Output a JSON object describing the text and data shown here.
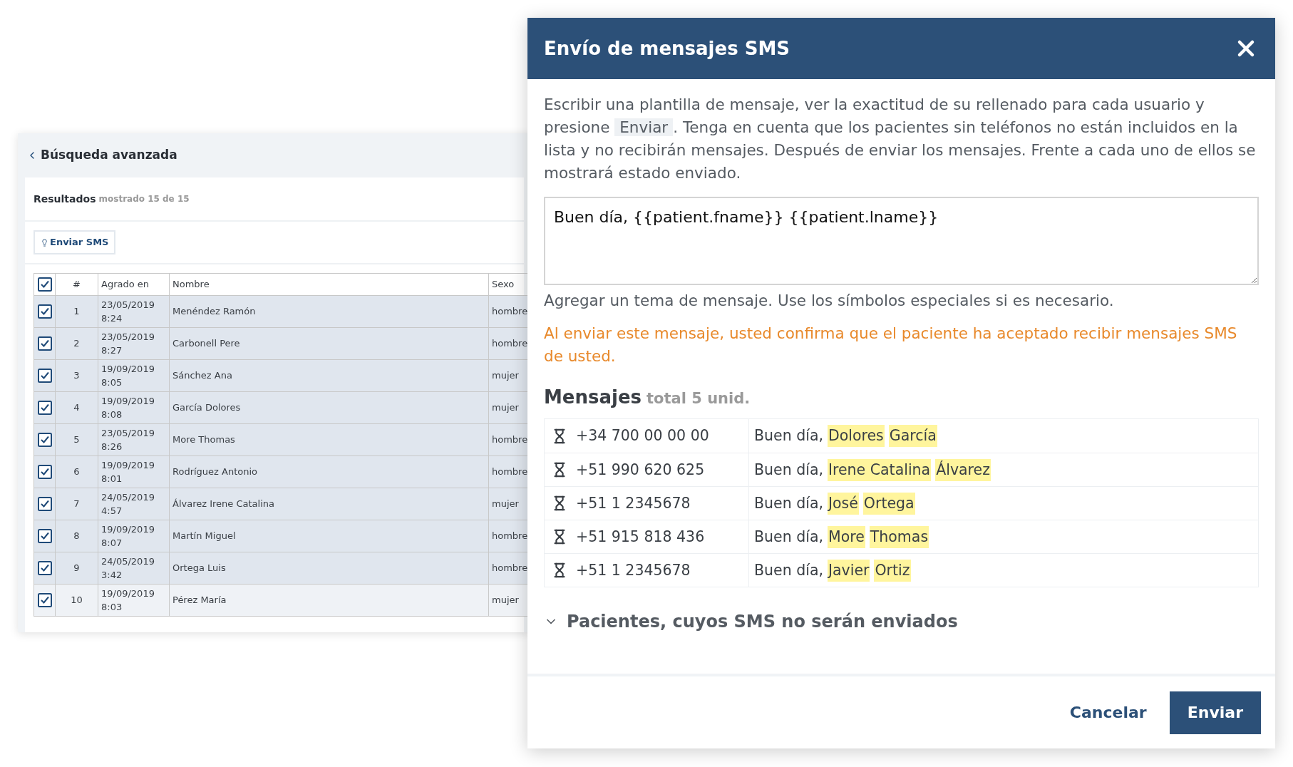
{
  "search_panel": {
    "back_title": "Búsqueda avanzada",
    "results_label": "Resultados",
    "results_count": "mostrado 15 de 15",
    "send_button": "Enviar SMS",
    "table": {
      "header_checked": true,
      "columns": [
        "#",
        "Agrado en",
        "Nombre",
        "Sexo"
      ],
      "rows": [
        {
          "checked": true,
          "highlighted": true,
          "num": "1",
          "date": "23/05/2019",
          "time": "8:24",
          "name": "Menéndez Ramón",
          "sex": "hombre"
        },
        {
          "checked": true,
          "highlighted": true,
          "num": "2",
          "date": "23/05/2019",
          "time": "8:27",
          "name": "Carbonell Pere",
          "sex": "hombre"
        },
        {
          "checked": true,
          "highlighted": true,
          "num": "3",
          "date": "19/09/2019",
          "time": "8:05",
          "name": "Sánchez Ana",
          "sex": "mujer"
        },
        {
          "checked": true,
          "highlighted": true,
          "num": "4",
          "date": "19/09/2019",
          "time": "8:08",
          "name": "García Dolores",
          "sex": "mujer"
        },
        {
          "checked": true,
          "highlighted": true,
          "num": "5",
          "date": "23/05/2019",
          "time": "8:26",
          "name": "More Thomas",
          "sex": "hombre"
        },
        {
          "checked": true,
          "highlighted": true,
          "num": "6",
          "date": "19/09/2019",
          "time": "8:01",
          "name": "Rodríguez Antonio",
          "sex": "hombre"
        },
        {
          "checked": true,
          "highlighted": true,
          "num": "7",
          "date": "24/05/2019",
          "time": "4:57",
          "name": "Álvarez Irene Catalina",
          "sex": "mujer"
        },
        {
          "checked": true,
          "highlighted": true,
          "num": "8",
          "date": "19/09/2019",
          "time": "8:07",
          "name": "Martín Miguel",
          "sex": "hombre"
        },
        {
          "checked": true,
          "highlighted": true,
          "num": "9",
          "date": "24/05/2019",
          "time": "3:42",
          "name": "Ortega Luis",
          "sex": "hombre"
        },
        {
          "checked": true,
          "highlighted": false,
          "num": "10",
          "date": "19/09/2019",
          "time": "8:03",
          "name": "Pérez María",
          "sex": "mujer"
        }
      ]
    }
  },
  "dialog": {
    "title": "Envío de mensajes SMS",
    "description_before": "Escribir una plantilla de mensaje, ver la exactitud de su rellenado para cada usuario y presione",
    "description_button": "Enviar",
    "description_after": ". Tenga en cuenta que los pacientes sin teléfonos no están incluidos en la lista y no recibirán mensajes. Después de enviar los mensajes. Frente a cada uno de ellos se mostrará estado enviado.",
    "template_value": "Buen día, {{patient.fname}} {{patient.lname}}",
    "hint": "Agregar un tema de mensaje. Use los símbolos especiales si es necesario.",
    "warning": "Al enviar este mensaje, usted confirma que el paciente ha aceptado recibir mensajes SMS de usted.",
    "messages_title": "Mensajes",
    "messages_total": "total 5 unid.",
    "messages": [
      {
        "phone": "+34 700 00 00 00",
        "greeting": "Buen día,",
        "names": [
          "Dolores",
          "García"
        ]
      },
      {
        "phone": "+51 990 620 625",
        "greeting": "Buen día,",
        "names": [
          "Irene Catalina",
          "Álvarez"
        ]
      },
      {
        "phone": "+51 1 2345678",
        "greeting": "Buen día,",
        "names": [
          "José",
          "Ortega"
        ]
      },
      {
        "phone": "+51 915 818 436",
        "greeting": "Buen día,",
        "names": [
          "More",
          "Thomas"
        ]
      },
      {
        "phone": "+51 1 2345678",
        "greeting": "Buen día,",
        "names": [
          "Javier",
          "Ortiz"
        ]
      }
    ],
    "excluded_section": {
      "label": "Pacientes, cuyos SMS no serán enviados",
      "expanded": false
    },
    "buttons": {
      "cancel": "Cancelar",
      "send": "Enviar"
    }
  }
}
